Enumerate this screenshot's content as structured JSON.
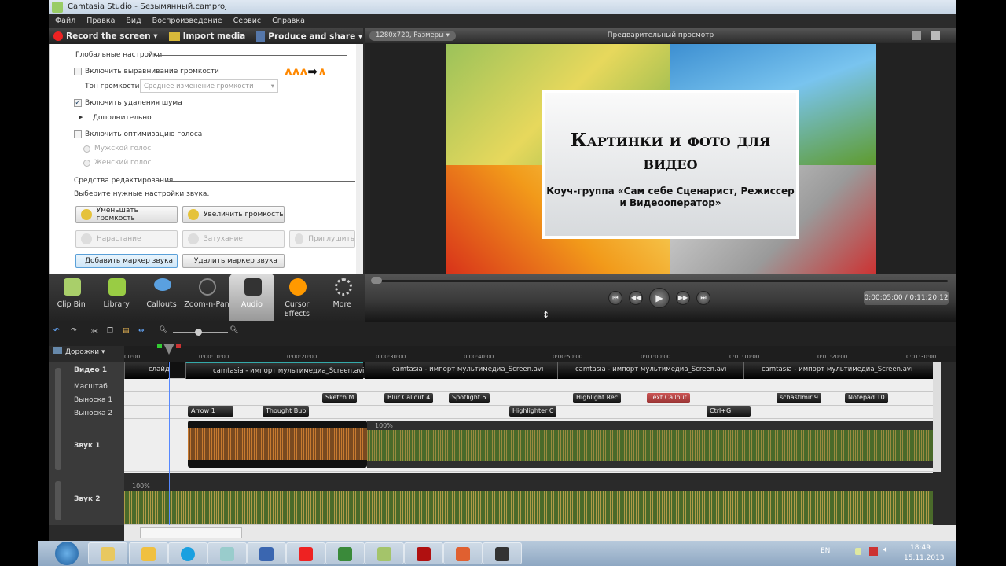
{
  "window": {
    "title": "Camtasia Studio - Безымянный.camproj"
  },
  "menu": [
    "Файл",
    "Правка",
    "Вид",
    "Воспроизведение",
    "Сервис",
    "Справка"
  ],
  "toolbar": {
    "record": "Record the screen ▾",
    "import": "Import media",
    "produce": "Produce and share ▾"
  },
  "audio_panel": {
    "global_header": "Глобальные настройки",
    "volume_leveling": "Включить выравнивание громкости",
    "volume_leveling_checked": false,
    "volume_tone_label": "Тон громкости:",
    "volume_tone_value": "Среднее изменение громкости",
    "noise_removal": "Включить удаления шума",
    "noise_removal_checked": true,
    "advanced": "Дополнительно",
    "voice_opt": "Включить оптимизацию голоса",
    "voice_opt_checked": false,
    "male": "Мужской голос",
    "female": "Женский голос",
    "tools_header": "Средства редактирования",
    "tools_hint": "Выберите нужные настройки звука.",
    "buttons": {
      "decrease": "Уменьшать громкость",
      "increase": "Увеличить громкость",
      "fade_in": "Нарастание",
      "fade_out": "Затухание",
      "mute": "Приглушить",
      "add_marker": "Добавить маркер звука",
      "remove_marker": "Удалить маркер звука"
    }
  },
  "tabs": [
    {
      "label": "Clip Bin"
    },
    {
      "label": "Library"
    },
    {
      "label": "Callouts"
    },
    {
      "label": "Zoom-n-Pan"
    },
    {
      "label": "Audio",
      "active": true
    },
    {
      "label": "Cursor Effects"
    },
    {
      "label": "More"
    }
  ],
  "preview": {
    "size": "1280x720, Размеры ▾",
    "title": "Предварительный просмотр",
    "slide_title": "Картинки и фото для видео",
    "slide_subtitle": "Коуч-группа «Сам себе Сценарист, Режиссер и Видеооператор»",
    "time": "0:00:05:00 / 0:11:20:12"
  },
  "timeline": {
    "tracks_menu": "Дорожки ▾",
    "ticks": [
      "00:00",
      "0:00:10:00",
      "0:00:20:00",
      "0:00:30:00",
      "0:00:40:00",
      "0:00:50:00",
      "0:01:00:00",
      "0:01:10:00",
      "0:01:20:00",
      "0:01:30:00"
    ],
    "track_labels": [
      "Видео 1",
      "Масштаб",
      "Выноска 1",
      "Выноска 2",
      "Звук 1",
      "Звук 2"
    ],
    "video_clips": [
      "слайд",
      "camtasia - импорт мультимедиа_Screen.avi",
      "camtasia - импорт мультимедиа_Screen.avi",
      "camtasia - импорт мультимедиа_Screen.avi",
      "camtasia - импорт мультимедиа_Screen.avi"
    ],
    "callouts1": [
      "Sketch M",
      "Blur Callout 4",
      "Spotlight 5",
      "Highlight Rec",
      "Text Callout",
      "schastlmir 9",
      "Notepad 10"
    ],
    "callouts2": [
      "Arrow 1",
      "Thought Bub",
      "Highlighter C",
      "Ctrl+G"
    ],
    "volume_label": "100%"
  },
  "taskbar": {
    "lang": "EN",
    "clock_time": "18:49",
    "clock_date": "15.11.2013",
    "apps": [
      "explorer",
      "outlook",
      "skype",
      "notepad",
      "word",
      "yandex",
      "excel",
      "green-app",
      "acrobat",
      "powerpoint",
      "camtasia-recorder"
    ]
  },
  "colors": {
    "accent_red": "#e22222",
    "wave_orange": "#c87a30",
    "wave_green": "#4a6a2a",
    "callout_red": "#b04040"
  }
}
